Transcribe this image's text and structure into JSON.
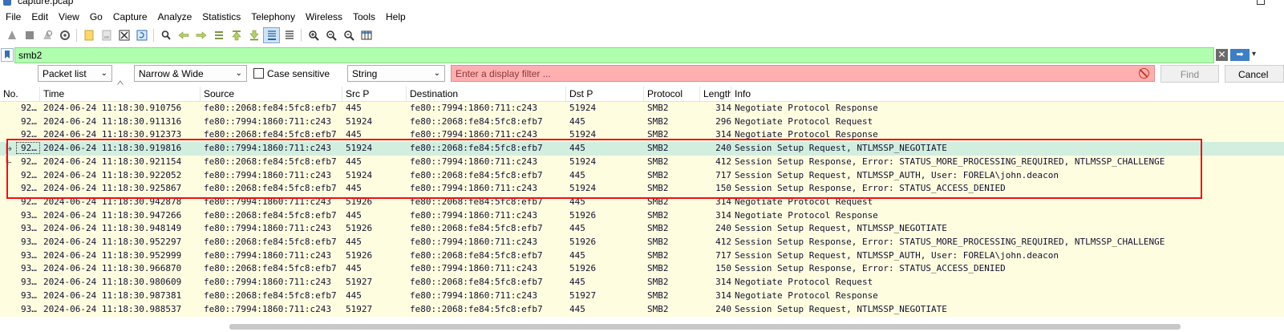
{
  "window": {
    "title": "capture.pcap"
  },
  "menu": [
    "File",
    "Edit",
    "View",
    "Go",
    "Capture",
    "Analyze",
    "Statistics",
    "Telephony",
    "Wireless",
    "Tools",
    "Help"
  ],
  "toolbar_icons": [
    "start-capture-icon",
    "stop-capture-icon",
    "restart-capture-icon",
    "capture-options-icon",
    "open-file-icon",
    "save-file-icon",
    "close-file-icon",
    "reload-file-icon",
    "find-packet-icon",
    "go-back-icon",
    "go-forward-icon",
    "go-to-packet-icon",
    "first-packet-icon",
    "last-packet-icon",
    "autoscroll-icon",
    "colorize-icon",
    "zoom-in-icon",
    "zoom-out-icon",
    "normal-size-icon",
    "resize-columns-icon"
  ],
  "display_filter": {
    "value": "smb2"
  },
  "find_bar": {
    "search_in": "Packet list",
    "char_width": "Narrow & Wide",
    "case_sensitive_label": "Case sensitive",
    "search_type": "String",
    "placeholder": "Enter a display filter ...",
    "find_label": "Find",
    "cancel_label": "Cancel"
  },
  "columns": [
    "No.",
    "Time",
    "Source",
    "Src P",
    "Destination",
    "Dst P",
    "Protocol",
    "Length",
    "Info"
  ],
  "packets": [
    {
      "no": "92…",
      "time": "2024-06-24 11:18:30.910756",
      "src": "fe80::2068:fe84:5fc8:efb7",
      "sport": "445",
      "dst": "fe80::7994:1860:711:c243",
      "dport": "51924",
      "proto": "SMB2",
      "len": "314",
      "info": "Negotiate Protocol Response"
    },
    {
      "no": "92…",
      "time": "2024-06-24 11:18:30.911316",
      "src": "fe80::7994:1860:711:c243",
      "sport": "51924",
      "dst": "fe80::2068:fe84:5fc8:efb7",
      "dport": "445",
      "proto": "SMB2",
      "len": "296",
      "info": "Negotiate Protocol Request"
    },
    {
      "no": "92…",
      "time": "2024-06-24 11:18:30.912373",
      "src": "fe80::2068:fe84:5fc8:efb7",
      "sport": "445",
      "dst": "fe80::7994:1860:711:c243",
      "dport": "51924",
      "proto": "SMB2",
      "len": "314",
      "info": "Negotiate Protocol Response"
    },
    {
      "no": "92…",
      "time": "2024-06-24 11:18:30.919816",
      "src": "fe80::7994:1860:711:c243",
      "sport": "51924",
      "dst": "fe80::2068:fe84:5fc8:efb7",
      "dport": "445",
      "proto": "SMB2",
      "len": "240",
      "info": "Session Setup Request, NTLMSSP_NEGOTIATE"
    },
    {
      "no": "92…",
      "time": "2024-06-24 11:18:30.921154",
      "src": "fe80::2068:fe84:5fc8:efb7",
      "sport": "445",
      "dst": "fe80::7994:1860:711:c243",
      "dport": "51924",
      "proto": "SMB2",
      "len": "412",
      "info": "Session Setup Response, Error: STATUS_MORE_PROCESSING_REQUIRED, NTLMSSP_CHALLENGE"
    },
    {
      "no": "92…",
      "time": "2024-06-24 11:18:30.922052",
      "src": "fe80::7994:1860:711:c243",
      "sport": "51924",
      "dst": "fe80::2068:fe84:5fc8:efb7",
      "dport": "445",
      "proto": "SMB2",
      "len": "717",
      "info": "Session Setup Request, NTLMSSP_AUTH, User: FORELA\\john.deacon"
    },
    {
      "no": "92…",
      "time": "2024-06-24 11:18:30.925867",
      "src": "fe80::2068:fe84:5fc8:efb7",
      "sport": "445",
      "dst": "fe80::7994:1860:711:c243",
      "dport": "51924",
      "proto": "SMB2",
      "len": "150",
      "info": "Session Setup Response, Error: STATUS_ACCESS_DENIED"
    },
    {
      "no": "92…",
      "time": "2024-06-24 11:18:30.942878",
      "src": "fe80::7994:1860:711:c243",
      "sport": "51926",
      "dst": "fe80::2068:fe84:5fc8:efb7",
      "dport": "445",
      "proto": "SMB2",
      "len": "314",
      "info": "Negotiate Protocol Request"
    },
    {
      "no": "93…",
      "time": "2024-06-24 11:18:30.947266",
      "src": "fe80::2068:fe84:5fc8:efb7",
      "sport": "445",
      "dst": "fe80::7994:1860:711:c243",
      "dport": "51926",
      "proto": "SMB2",
      "len": "314",
      "info": "Negotiate Protocol Response"
    },
    {
      "no": "93…",
      "time": "2024-06-24 11:18:30.948149",
      "src": "fe80::7994:1860:711:c243",
      "sport": "51926",
      "dst": "fe80::2068:fe84:5fc8:efb7",
      "dport": "445",
      "proto": "SMB2",
      "len": "240",
      "info": "Session Setup Request, NTLMSSP_NEGOTIATE"
    },
    {
      "no": "93…",
      "time": "2024-06-24 11:18:30.952297",
      "src": "fe80::2068:fe84:5fc8:efb7",
      "sport": "445",
      "dst": "fe80::7994:1860:711:c243",
      "dport": "51926",
      "proto": "SMB2",
      "len": "412",
      "info": "Session Setup Response, Error: STATUS_MORE_PROCESSING_REQUIRED, NTLMSSP_CHALLENGE"
    },
    {
      "no": "93…",
      "time": "2024-06-24 11:18:30.952999",
      "src": "fe80::7994:1860:711:c243",
      "sport": "51926",
      "dst": "fe80::2068:fe84:5fc8:efb7",
      "dport": "445",
      "proto": "SMB2",
      "len": "717",
      "info": "Session Setup Request, NTLMSSP_AUTH, User: FORELA\\john.deacon"
    },
    {
      "no": "93…",
      "time": "2024-06-24 11:18:30.966870",
      "src": "fe80::2068:fe84:5fc8:efb7",
      "sport": "445",
      "dst": "fe80::7994:1860:711:c243",
      "dport": "51926",
      "proto": "SMB2",
      "len": "150",
      "info": "Session Setup Response, Error: STATUS_ACCESS_DENIED"
    },
    {
      "no": "93…",
      "time": "2024-06-24 11:18:30.980609",
      "src": "fe80::7994:1860:711:c243",
      "sport": "51927",
      "dst": "fe80::2068:fe84:5fc8:efb7",
      "dport": "445",
      "proto": "SMB2",
      "len": "314",
      "info": "Negotiate Protocol Request"
    },
    {
      "no": "93…",
      "time": "2024-06-24 11:18:30.987381",
      "src": "fe80::2068:fe84:5fc8:efb7",
      "sport": "445",
      "dst": "fe80::7994:1860:711:c243",
      "dport": "51927",
      "proto": "SMB2",
      "len": "314",
      "info": "Negotiate Protocol Response"
    },
    {
      "no": "93…",
      "time": "2024-06-24 11:18:30.988537",
      "src": "fe80::7994:1860:711:c243",
      "sport": "51927",
      "dst": "fe80::2068:fe84:5fc8:efb7",
      "dport": "445",
      "proto": "SMB2",
      "len": "240",
      "info": "Session Setup Request, NTLMSSP_NEGOTIATE"
    }
  ],
  "colors": {
    "row_bg": "#fffde0",
    "selected_row_bg": "#d2eedf",
    "filter_valid_bg": "#afffaf",
    "filter_invalid_bg": "#ffafaf",
    "annotation_box": "#ee1111"
  }
}
